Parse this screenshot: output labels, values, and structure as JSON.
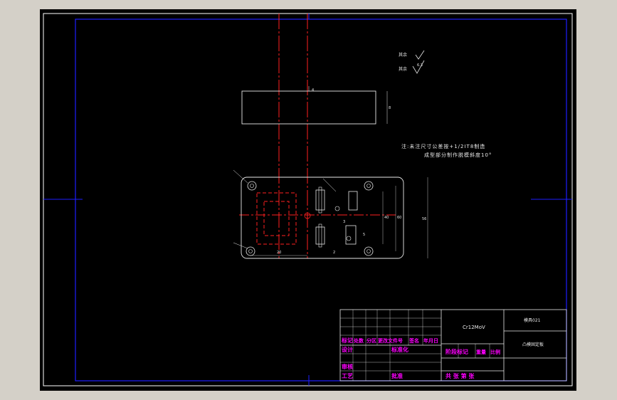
{
  "notes": {
    "roughness_label1": "其余",
    "roughness_label2": "其余",
    "roughness_val": "6.3",
    "note_line1": "注:未注尺寸公差按+1/2IT8制造",
    "note_line2": "成型部分制作脱模斜度10°"
  },
  "dimensions": {
    "d_56": "56",
    "d_20": "20",
    "d_40": "40",
    "d_60": "60",
    "d_top": "4",
    "d_side": "8",
    "d_r1": "2",
    "d_r2": "5",
    "d_r3": "3"
  },
  "title_block": {
    "material": "Cr12MoV",
    "drawing_no": "模具021",
    "part_name": "凸模固定板",
    "h_mark": "标记",
    "h_count": "处数",
    "h_zone": "分区",
    "h_change": "更改文件号",
    "h_sign": "签名",
    "h_date": "年月日",
    "h_design": "设计",
    "h_std": "标准化",
    "h_stage": "阶段标记",
    "h_weight": "重量",
    "h_scale": "比例",
    "h_check": "审核",
    "h_process": "工艺",
    "h_approve": "批准",
    "h_sheets": "共  张 第  张"
  }
}
